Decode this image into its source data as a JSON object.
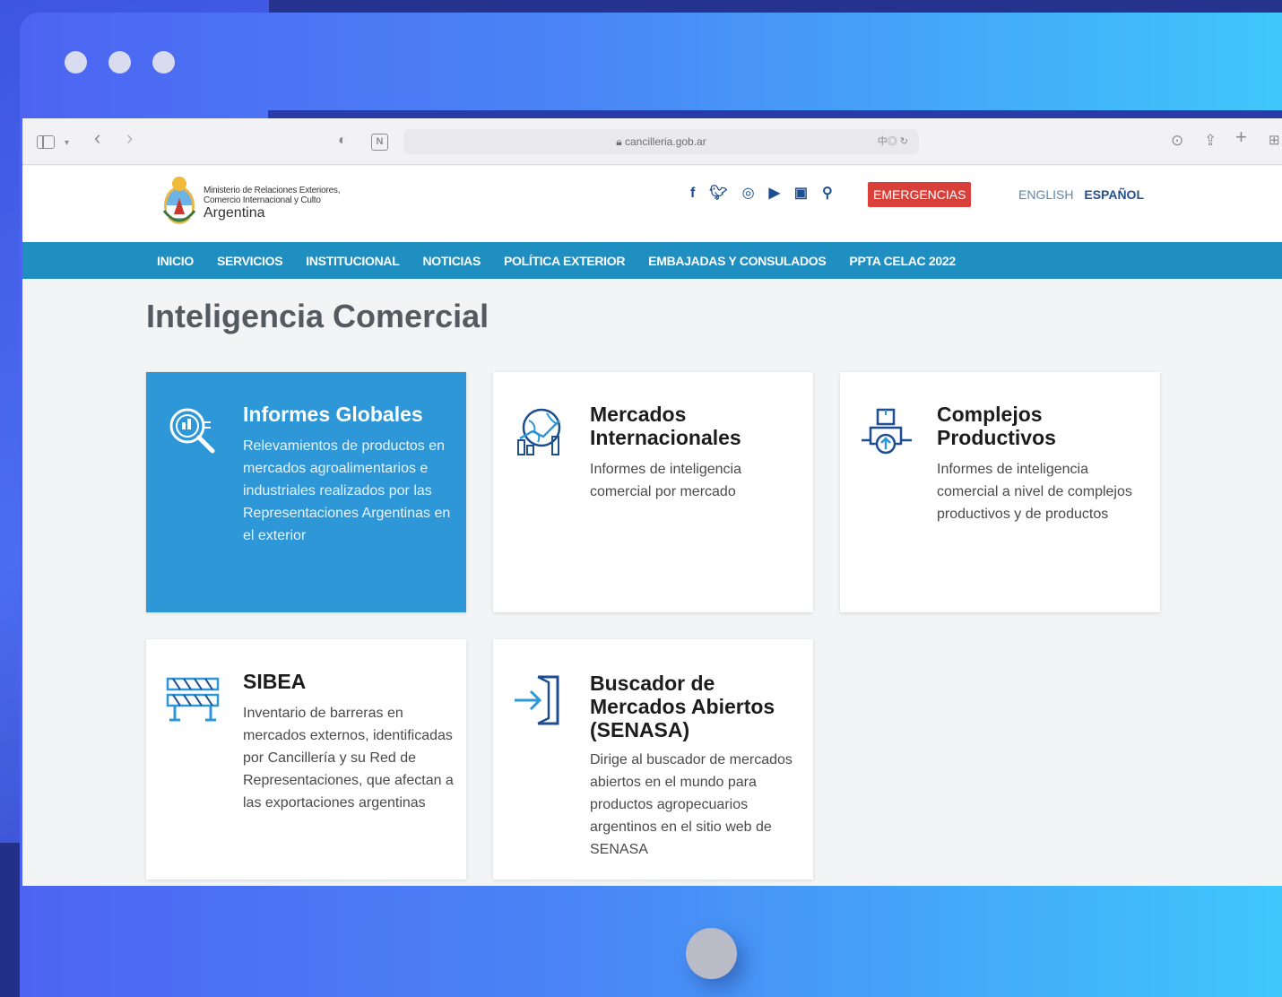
{
  "browser": {
    "url": "cancilleria.gob.ar",
    "url_tools": "中◎ ↻"
  },
  "header": {
    "logo_line1": "Ministerio de Relaciones Exteriores,",
    "logo_line2": "Comercio Internacional y Culto",
    "logo_line3": "Argentina",
    "emergency_label": "EMERGENCIAS",
    "lang_english": "ENGLISH",
    "lang_spanish": "ESPAÑOL"
  },
  "social_icons": [
    "facebook-icon",
    "twitter-icon",
    "instagram-icon",
    "youtube-icon",
    "flickr-icon",
    "search-icon"
  ],
  "nav": {
    "items": [
      "INICIO",
      "SERVICIOS",
      "INSTITUCIONAL",
      "NOTICIAS",
      "POLÍTICA EXTERIOR",
      "EMBAJADAS Y CONSULADOS",
      "PPTA CELAC 2022"
    ]
  },
  "page": {
    "title": "Inteligencia Comercial"
  },
  "cards": [
    {
      "title": "Informes Globales",
      "description": "Relevamientos de productos en mercados agroalimentarios e industriales realizados por las Representaciones Argentinas en el exterior",
      "icon": "magnifier-chart-icon",
      "active": true
    },
    {
      "title": "Mercados Internacionales",
      "description": "Informes de inteligencia comercial por mercado",
      "icon": "globe-chart-icon",
      "active": false
    },
    {
      "title": "Complejos Productivos",
      "description": "Informes de inteligencia comercial a nivel de complejos productivos y de productos",
      "icon": "package-hand-icon",
      "active": false
    },
    {
      "title": "SIBEA",
      "description": "Inventario de barreras en mercados externos, identificadas por Cancillería y su Red de Representaciones, que afectan a las exportaciones argentinas",
      "icon": "barrier-icon",
      "active": false
    },
    {
      "title": "Buscador de Mercados Abiertos (SENASA)",
      "description": "Dirige al buscador de mercados abiertos en el mundo para productos agropecuarios argentinos en el sitio web de SENASA",
      "icon": "enter-door-icon",
      "active": false
    }
  ],
  "colors": {
    "nav_bar": "#1f8ec1",
    "active_card": "#2d97d8",
    "emergency": "#d9403a",
    "brand_dark": "#1d4e8f"
  }
}
